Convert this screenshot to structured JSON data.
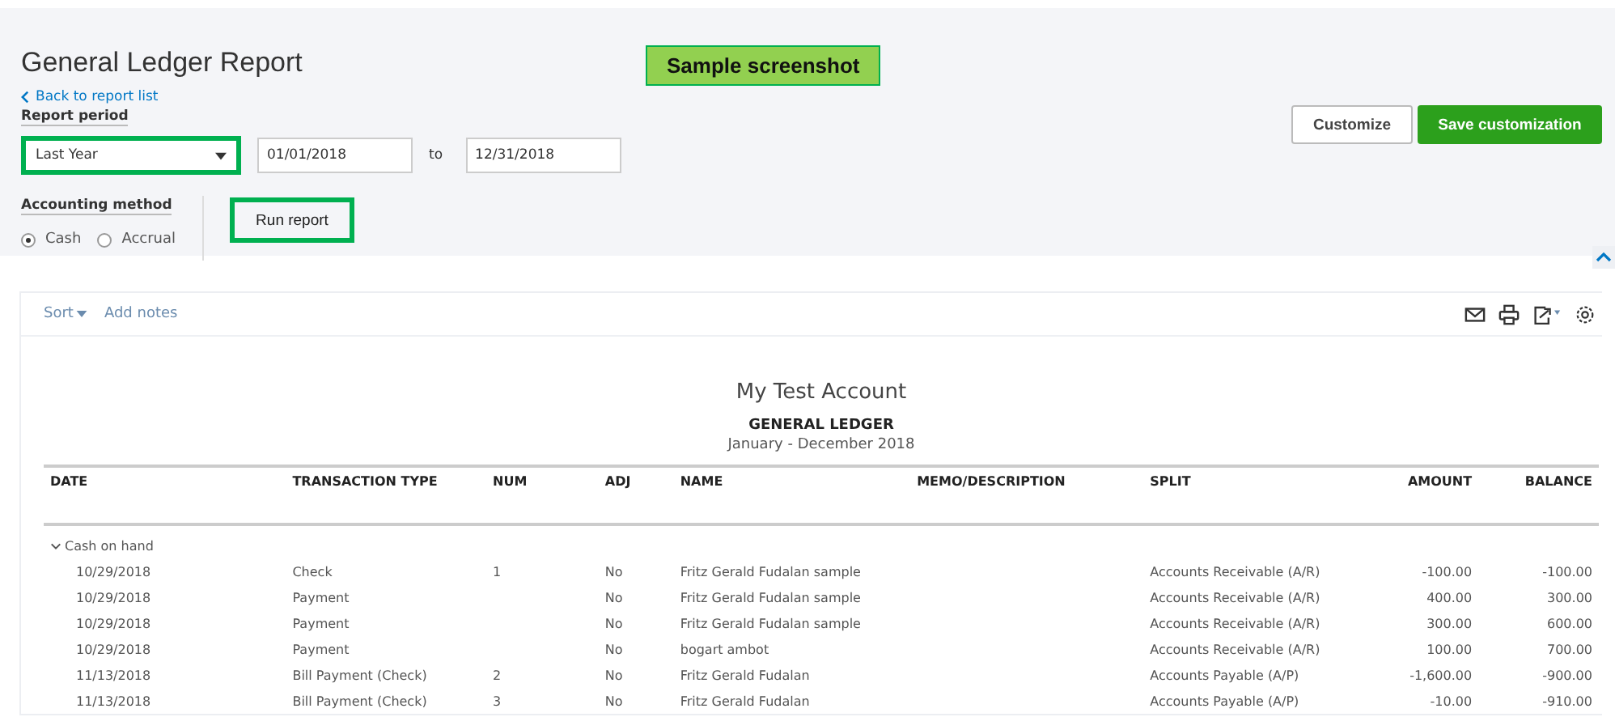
{
  "header": {
    "title": "General Ledger Report",
    "back_link": "Back to report list",
    "annotation": "Sample screenshot",
    "report_period_label": "Report period",
    "period": "Last Year",
    "start_date": "01/01/2018",
    "to_label": "to",
    "end_date": "12/31/2018",
    "accounting_method_label": "Accounting method",
    "methods": [
      {
        "label": "Cash",
        "selected": true
      },
      {
        "label": "Accrual",
        "selected": false
      }
    ],
    "run_button": "Run report",
    "customize_button": "Customize",
    "save_button": "Save customization"
  },
  "toolbar": {
    "sort": "Sort",
    "add_notes": "Add notes"
  },
  "report": {
    "company": "My Test Account",
    "title": "GENERAL LEDGER",
    "period": "January - December 2018",
    "columns": [
      "DATE",
      "TRANSACTION TYPE",
      "NUM",
      "ADJ",
      "NAME",
      "MEMO/DESCRIPTION",
      "SPLIT",
      "AMOUNT",
      "BALANCE"
    ],
    "group": {
      "label": "Cash on hand",
      "expanded": true
    },
    "rows": [
      [
        "10/29/2018",
        "Check",
        "1",
        "No",
        "Fritz Gerald Fudalan sample",
        "",
        "Accounts Receivable (A/R)",
        "-100.00",
        "-100.00"
      ],
      [
        "10/29/2018",
        "Payment",
        "",
        "No",
        "Fritz Gerald Fudalan sample",
        "",
        "Accounts Receivable (A/R)",
        "400.00",
        "300.00"
      ],
      [
        "10/29/2018",
        "Payment",
        "",
        "No",
        "Fritz Gerald Fudalan sample",
        "",
        "Accounts Receivable (A/R)",
        "300.00",
        "600.00"
      ],
      [
        "10/29/2018",
        "Payment",
        "",
        "No",
        "bogart ambot",
        "",
        "Accounts Receivable (A/R)",
        "100.00",
        "700.00"
      ],
      [
        "11/13/2018",
        "Bill Payment (Check)",
        "2",
        "No",
        "Fritz Gerald Fudalan",
        "",
        "Accounts Payable (A/P)",
        "-1,600.00",
        "-900.00"
      ],
      [
        "11/13/2018",
        "Bill Payment (Check)",
        "3",
        "No",
        "Fritz Gerald Fudalan",
        "",
        "Accounts Payable (A/P)",
        "-10.00",
        "-910.00"
      ]
    ]
  }
}
